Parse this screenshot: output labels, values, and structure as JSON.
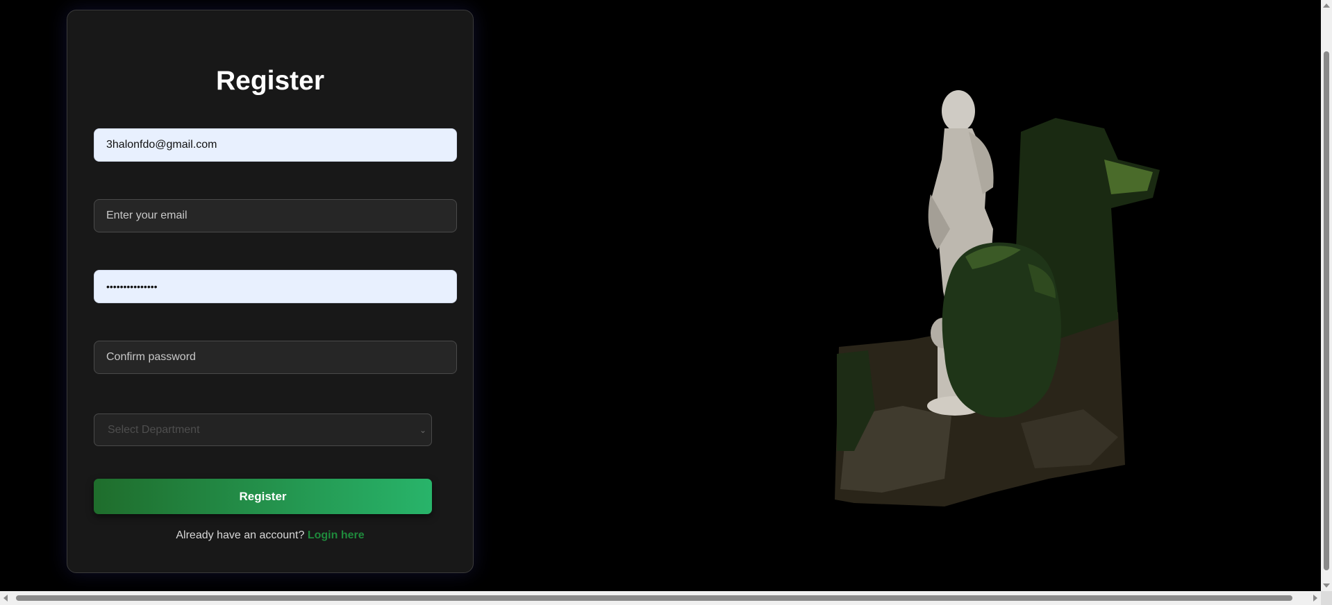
{
  "form": {
    "title": "Register",
    "email_value": "3halonfdo@gmail.com",
    "confirm_email_placeholder": "Enter your email",
    "password_value": "•••••••••••••••",
    "confirm_password_placeholder": "Confirm password",
    "department_placeholder": "Select Department",
    "submit_label": "Register",
    "footer_text": "Already have an account?",
    "login_link": "Login here"
  },
  "colors": {
    "background": "#000000",
    "card": "#181818",
    "accent_green": "#28b46a",
    "link_green": "#1f8a3c",
    "autofill": "#e8f0fe"
  },
  "scene": {
    "icon": "statue-garden-3d-model"
  }
}
